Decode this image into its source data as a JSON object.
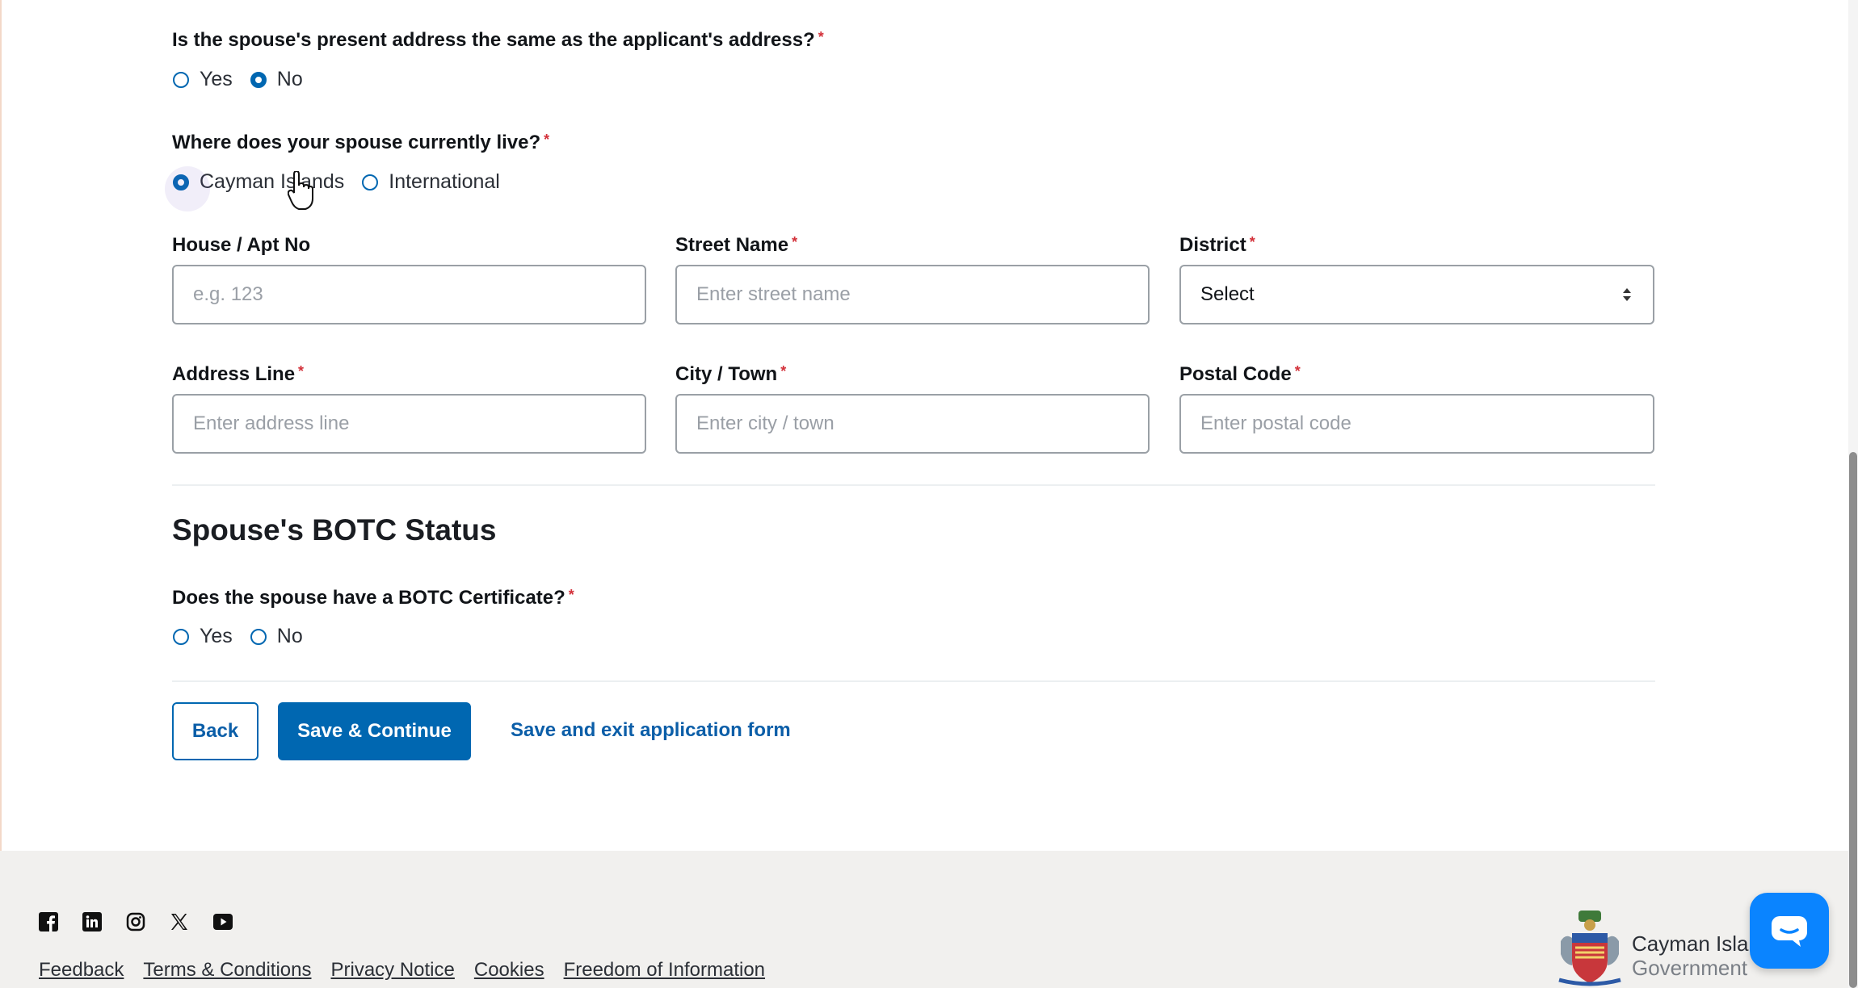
{
  "q_same_address": {
    "text": "Is the spouse's present address the same as the applicant's address?",
    "req": "*",
    "options": [
      {
        "label": "Yes",
        "checked": false
      },
      {
        "label": "No",
        "checked": true
      }
    ]
  },
  "q_spouse_live": {
    "text": "Where does your spouse currently live?",
    "req": "*",
    "options": [
      {
        "label": "Cayman Islands",
        "checked": true
      },
      {
        "label": "International",
        "checked": false
      }
    ]
  },
  "address": {
    "house": {
      "label": "House / Apt No",
      "placeholder": "e.g. 123"
    },
    "street": {
      "label": "Street Name",
      "req": "*",
      "placeholder": "Enter street name"
    },
    "district": {
      "label": "District",
      "req": "*",
      "value": "Select"
    },
    "address_line": {
      "label": "Address Line",
      "req": "*",
      "placeholder": "Enter address line"
    },
    "city": {
      "label": "City / Town",
      "req": "*",
      "placeholder": "Enter city / town"
    },
    "postal": {
      "label": "Postal Code",
      "req": "*",
      "placeholder": "Enter postal code"
    }
  },
  "botc": {
    "heading": "Spouse's BOTC Status",
    "question": "Does the spouse have a BOTC Certificate?",
    "req": "*",
    "options": [
      {
        "label": "Yes",
        "checked": false
      },
      {
        "label": "No",
        "checked": false
      }
    ]
  },
  "actions": {
    "back": "Back",
    "save_continue": "Save & Continue",
    "save_exit": "Save and exit application form"
  },
  "footer": {
    "social_icons": [
      "facebook-icon",
      "linkedin-icon",
      "instagram-icon",
      "x-icon",
      "youtube-icon"
    ],
    "links": [
      "Feedback",
      "Terms & Conditions",
      "Privacy Notice",
      "Cookies",
      "Freedom of Information"
    ],
    "brand_name": "Cayman Isla",
    "brand_sub": "Government"
  },
  "colors": {
    "primary": "#0067b1",
    "required": "#d3313a",
    "footer_bg": "#f1f0ee",
    "chat": "#0a84ff"
  }
}
